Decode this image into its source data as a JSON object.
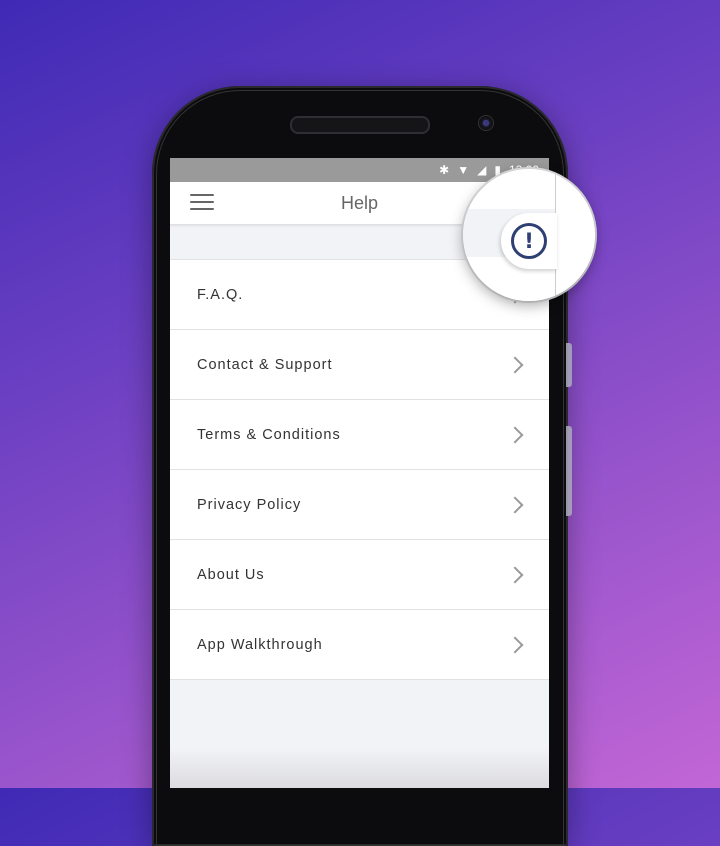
{
  "status_bar": {
    "bluetooth_icon": "✱",
    "wifi_icon": "▼",
    "signal_icon": "◢",
    "battery_icon": "▮",
    "time": "12:00"
  },
  "app_bar": {
    "title": "Help",
    "menu_icon": "hamburger-menu-icon"
  },
  "alert_badge": {
    "glyph": "!",
    "icon": "exclamation-circle-icon"
  },
  "help_menu": {
    "items": [
      {
        "label": "F.A.Q."
      },
      {
        "label": "Contact & Support"
      },
      {
        "label": "Terms & Conditions"
      },
      {
        "label": "Privacy Policy"
      },
      {
        "label": "About Us"
      },
      {
        "label": "App Walkthrough"
      }
    ]
  },
  "colors": {
    "accent": "#2e3f73",
    "background_start": "#3f2ab5",
    "background_end": "#c266d6"
  }
}
